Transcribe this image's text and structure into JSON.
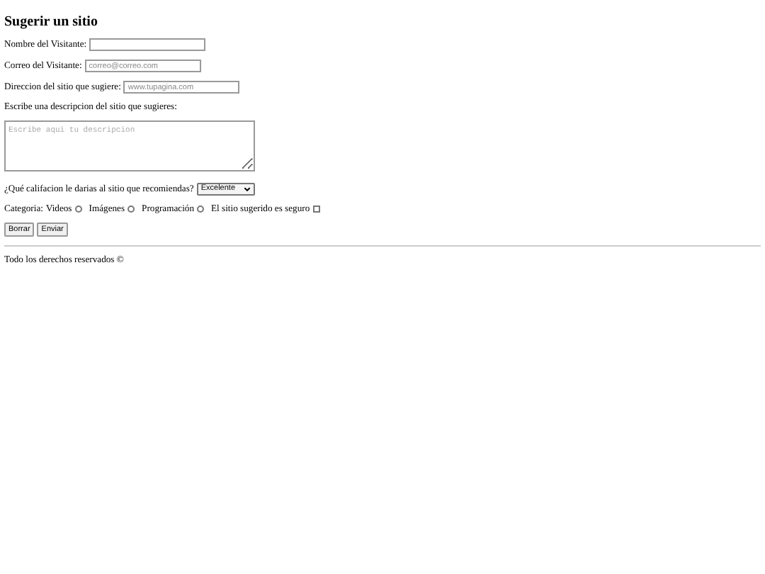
{
  "title": "Sugerir un sitio",
  "fields": [
    {
      "label": "Nombre del Visitante:"
    },
    {
      "label": "Correo del Visitante:",
      "placeholder": "correo@correo.com"
    },
    {
      "label": "Direccion del sitio que sugiere:",
      "placeholder": "www.tupagina.com"
    }
  ],
  "description": {
    "label": "Escribe una descripcion del sitio que sugieres:",
    "placeholder": "Escribe aqui tu descripcion"
  },
  "rating": {
    "label": "¿Qué califacion le darias al sitio que recomiendas?",
    "value": "Excelente"
  },
  "category": {
    "label": "Categoria:",
    "options": [
      {
        "label": "Videos",
        "kind": "radio",
        "checked": false
      },
      {
        "label": "Imágenes",
        "kind": "radio",
        "checked": false
      },
      {
        "label": "Programación",
        "kind": "radio",
        "checked": false
      },
      {
        "label": "El sitio sugerido es seguro",
        "kind": "checkbox",
        "checked": false
      }
    ]
  },
  "buttons": [
    "Borrar",
    "Enviar"
  ],
  "footer": "Todo los derechos reservados ©"
}
